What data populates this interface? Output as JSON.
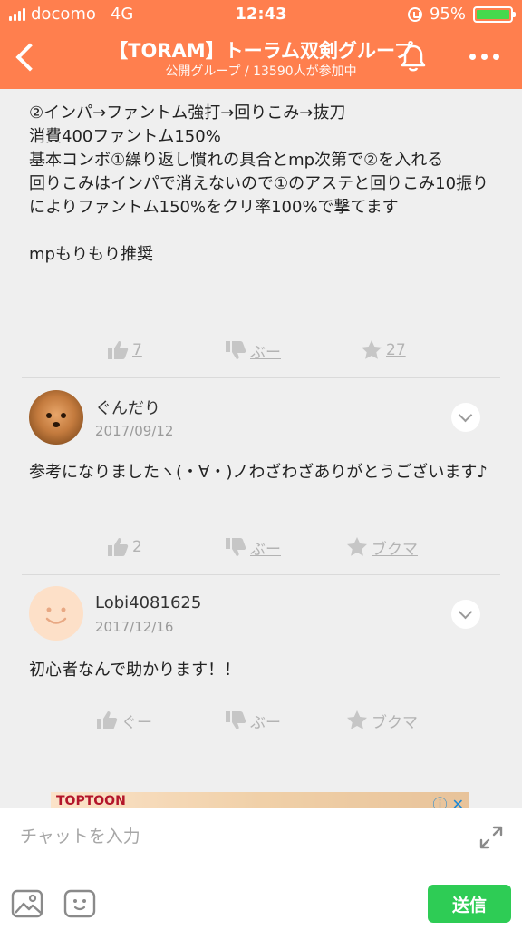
{
  "status": {
    "carrier": "docomo",
    "network": "4G",
    "time": "12:43",
    "battery": "95%"
  },
  "header": {
    "title": "【TORAM】トーラム双剣グループ",
    "subtitle": "公開グループ / 13590人が参加中"
  },
  "post": {
    "text": "②インパ→ファントム強打→回りこみ→抜刀\n消費400ファントム150%\n基本コンボ①繰り返し慣れの具合とmp次第で②を入れる\n回りこみはインパで消えないので①のアステと回りこみ10振りによりファントム150%をクリ率100%で撃てます\n\nmpもりもり推奨",
    "like": "7",
    "dislike": "ぶー",
    "bookmark": "27"
  },
  "comments": [
    {
      "name": "ぐんだり",
      "date": "2017/09/12",
      "text": "参考になりましたヽ(・∀・)ノわざわざありがとうございます♪",
      "like": "2",
      "dislike": "ぶー",
      "bookmark": "ブクマ"
    },
    {
      "name": "Lobi4081625",
      "date": "2017/12/16",
      "text": "初心者なんで助かります！！",
      "like": "ぐー",
      "dislike": "ぶー",
      "bookmark": "ブクマ"
    }
  ],
  "ad": {
    "logo": "TOPTOON",
    "close": "ⓘ ✕"
  },
  "footer": {
    "input_placeholder": "チャットを入力",
    "send_label": "送信"
  },
  "colors": {
    "accent": "#ff7f4e",
    "send": "#2ecc55",
    "muted": "#b3b3b3"
  }
}
